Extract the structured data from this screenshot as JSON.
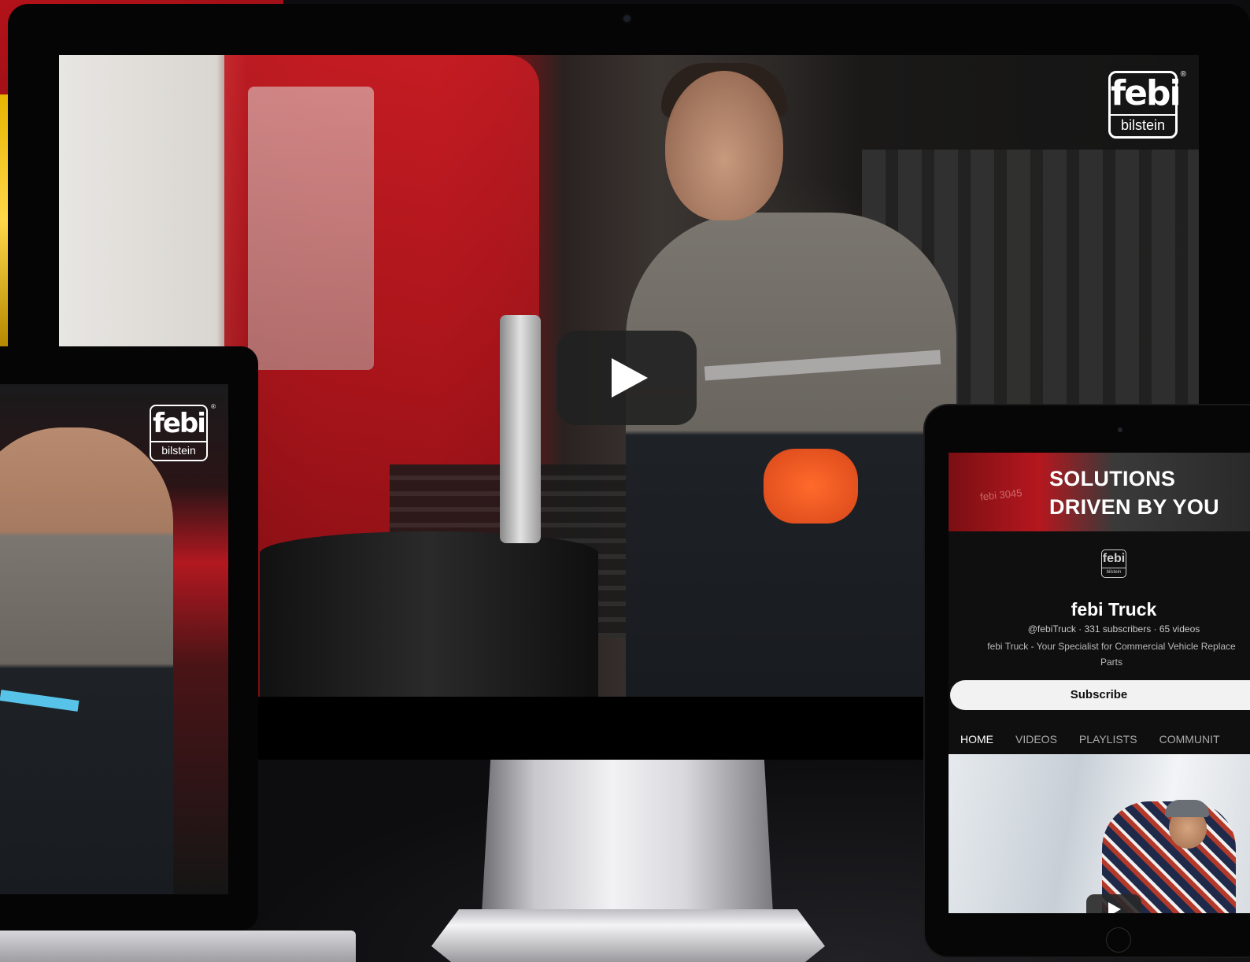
{
  "colors": {
    "brand_red": "#c41c23",
    "play_button_bg": "#212121",
    "subscribe_bg": "#f2f2f2",
    "tab_active": "#ffffff",
    "tab_inactive": "#aaaaaa"
  },
  "brand": {
    "logo_main": "febi",
    "logo_sub": "bilstein",
    "registered_mark": "®"
  },
  "monitor": {
    "play_icon": "play-icon"
  },
  "tablet": {
    "banner": {
      "line1": "SOLUTIONS",
      "line2": "DRIVEN BY YOU",
      "stamp_text": "febi 3045"
    },
    "channel": {
      "name": "febi Truck",
      "stats": "@febiTruck · 331 subscribers · 65 videos",
      "description_line1": "febi Truck - Your Specialist for Commercial Vehicle Replace",
      "description_line2": "Parts"
    },
    "subscribe_label": "Subscribe",
    "tabs": [
      {
        "label": "HOME",
        "active": true
      },
      {
        "label": "VIDEOS",
        "active": false
      },
      {
        "label": "PLAYLISTS",
        "active": false
      },
      {
        "label": "COMMUNIT",
        "active": false
      }
    ]
  }
}
